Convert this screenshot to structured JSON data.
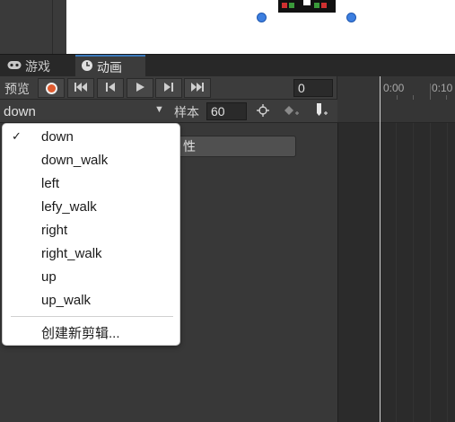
{
  "tabs": [
    {
      "label": "游戏",
      "icon": "gamepad-icon"
    },
    {
      "label": "动画",
      "icon": "clock-icon"
    }
  ],
  "toolbar": {
    "preview_label": "预览",
    "frame_value": "0",
    "buttons": [
      "record-icon",
      "first-key-icon",
      "prev-key-icon",
      "play-icon",
      "next-key-icon",
      "last-key-icon"
    ]
  },
  "timeline": {
    "tick_labels": [
      "0:00",
      "0:10"
    ]
  },
  "clip_bar": {
    "selected_clip": "down",
    "sample_label": "样本",
    "sample_value": "60"
  },
  "properties": {
    "add_property_label_partial": "性"
  },
  "dropdown": {
    "items": [
      {
        "label": "down",
        "checked": true
      },
      {
        "label": "down_walk",
        "checked": false
      },
      {
        "label": "left",
        "checked": false
      },
      {
        "label": "lefy_walk",
        "checked": false
      },
      {
        "label": "right",
        "checked": false
      },
      {
        "label": "right_walk",
        "checked": false
      },
      {
        "label": "up",
        "checked": false
      },
      {
        "label": "up_walk",
        "checked": false
      }
    ],
    "create_label": "创建新剪辑..."
  },
  "colors": {
    "record": "#e05b2f",
    "tab_accent": "#3a79bb",
    "handle": "#3d7fe0"
  }
}
